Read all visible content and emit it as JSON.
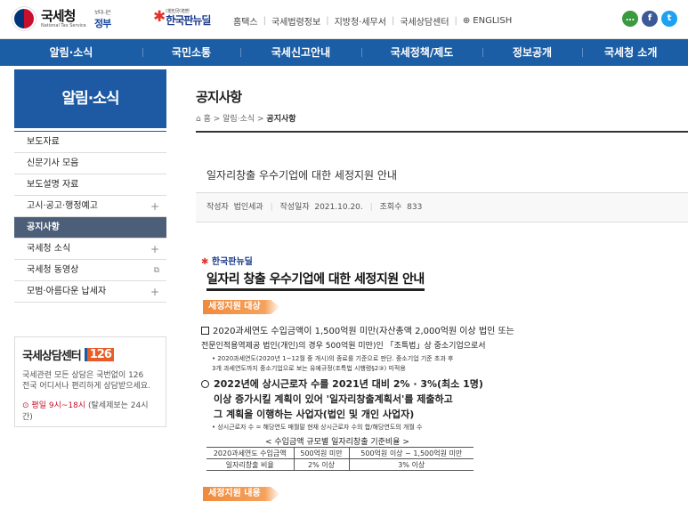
{
  "header": {
    "logo_ko": "국세청",
    "logo_en": "National Tax Service",
    "slogan_small": "보다나은",
    "slogan": "정부",
    "newdeal_small": "대한민국 대전환",
    "newdeal": "한국판뉴딜",
    "util_links": [
      "홈택스",
      "국세법령정보",
      "지방청·세무서",
      "국세상담센터",
      "ENGLISH"
    ],
    "sns": [
      {
        "name": "talk",
        "glyph": "…",
        "color": "#3b9a3f"
      },
      {
        "name": "facebook",
        "glyph": "f",
        "color": "#3b5998"
      },
      {
        "name": "twitter",
        "glyph": "t",
        "color": "#1da1f2"
      }
    ]
  },
  "gnb": [
    "알림·소식",
    "국민소통",
    "국세신고안내",
    "국세정책/제도",
    "정보공개",
    "국세청 소개"
  ],
  "sidebar": {
    "title": "알림·소식",
    "items": [
      {
        "label": "보도자료",
        "mark": ""
      },
      {
        "label": "신문기사 모음",
        "mark": ""
      },
      {
        "label": "보도설명 자료",
        "mark": ""
      },
      {
        "label": "고시·공고·행정예고",
        "mark": "+"
      },
      {
        "label": "공지사항",
        "mark": "",
        "active": true
      },
      {
        "label": "국세청 소식",
        "mark": "+"
      },
      {
        "label": "국세청 동영상",
        "mark": "⧉"
      },
      {
        "label": "모범·아름다운 납세자",
        "mark": "+"
      }
    ]
  },
  "consult": {
    "title": "국세상담센터",
    "number": "126",
    "desc_line1": "국세관련 모든 상담은 국번없이 126",
    "desc_line2": "전국 어디서나 편리하게 상담받으세요.",
    "hours_highlight": "평일 9시~18시",
    "hours_note": "(탈세제보는 24시간)"
  },
  "page": {
    "title": "공지사항",
    "breadcrumb": [
      "홈",
      "알림·소식",
      "공지사항"
    ]
  },
  "post": {
    "title": "일자리창출 우수기업에 대한 세정지원 안내",
    "author_label": "작성자",
    "author": "법인세과",
    "date_label": "작성일자",
    "date": "2021.10.20.",
    "views_label": "조회수",
    "views": "833"
  },
  "doc": {
    "logo": "한국판뉴딜",
    "heading": "일자리 창출 우수기업에 대한 세정지원 안내",
    "sec1": "세정지원 대상",
    "l1": "2020과세연도 수입금액이 1,500억원 미만(자산총액 2,000억원 이상 법인 또는",
    "l2": "전문인적용역제공 법인(개인)의 경우 500억원 미만)인 「조특법」상 중소기업으로서",
    "l3": "• 2020과세연도(2020년 1~12월 중 개시)의 종료를 기준으로 판단. 중소기업 기준 초과 후",
    "l4": "3개 과세연도까지 중소기업으로 보는 유예규정(조특법 시행령§2③) 미적용",
    "l5": "2022년에 상시근로자 수를 2021년 대비 2% · 3%(최소 1명)",
    "l6": "이상 증가시킬 계획이 있어 '일자리창출계획서'를 제출하고",
    "l7": "그 계획을 이행하는 사업자(법인 및 개인 사업자)",
    "l8": "• 상시근로자 수 = 해당연도 매월말 현재 상시근로자 수의 합/해당연도의 개월 수",
    "table_caption": "< 수입금액 규모별 일자리창출 기준비율 >",
    "table_head": [
      "2020과세연도 수입금액",
      "500억원 미만",
      "500억원 이상 ~ 1,500억원 미만"
    ],
    "table_row": [
      "일자리창출 비율",
      "2% 이상",
      "3% 이상"
    ],
    "sec2": "세정지원 내용"
  }
}
